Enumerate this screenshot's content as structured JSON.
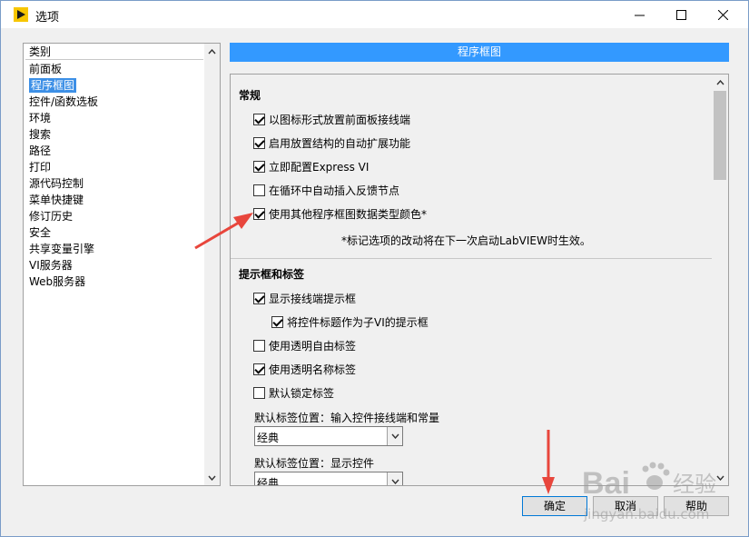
{
  "window": {
    "title": "选项"
  },
  "categories": {
    "header": "类别",
    "items": [
      "前面板",
      "程序框图",
      "控件/函数选板",
      "环境",
      "搜索",
      "路径",
      "打印",
      "源代码控制",
      "菜单快捷键",
      "修订历史",
      "安全",
      "共享变量引擎",
      "VI服务器",
      "Web服务器"
    ],
    "selected_index": 1
  },
  "panel": {
    "section_title": "程序框图",
    "general": {
      "title": "常规",
      "options": [
        {
          "label": "以图标形式放置前面板接线端",
          "checked": true
        },
        {
          "label": "启用放置结构的自动扩展功能",
          "checked": true
        },
        {
          "label": "立即配置Express VI",
          "checked": true
        },
        {
          "label": "在循环中自动插入反馈节点",
          "checked": false
        },
        {
          "label": "使用其他程序框图数据类型颜色*",
          "checked": true
        }
      ],
      "note": "*标记选项的改动将在下一次启动LabVIEW时生效。"
    },
    "tips": {
      "title": "提示框和标签",
      "options": [
        {
          "label": "显示接线端提示框",
          "checked": true
        },
        {
          "label": "将控件标题作为子VI的提示框",
          "checked": true
        },
        {
          "label": "使用透明自由标签",
          "checked": false
        },
        {
          "label": "使用透明名称标签",
          "checked": true
        },
        {
          "label": "默认锁定标签",
          "checked": false
        }
      ],
      "label_pos_input_label": "默认标签位置：输入控件接线端和常量",
      "label_pos_input_value": "经典",
      "label_pos_output_label": "默认标签位置：显示控件",
      "label_pos_output_value": "经典"
    }
  },
  "buttons": {
    "ok": "确定",
    "cancel": "取消",
    "help": "帮助"
  },
  "watermark": {
    "brand": "Bai",
    "brand_suffix": "经验",
    "url": "jingyan.baidu.com"
  },
  "colors": {
    "accent": "#3399ff",
    "annotation": "#e8463c"
  }
}
